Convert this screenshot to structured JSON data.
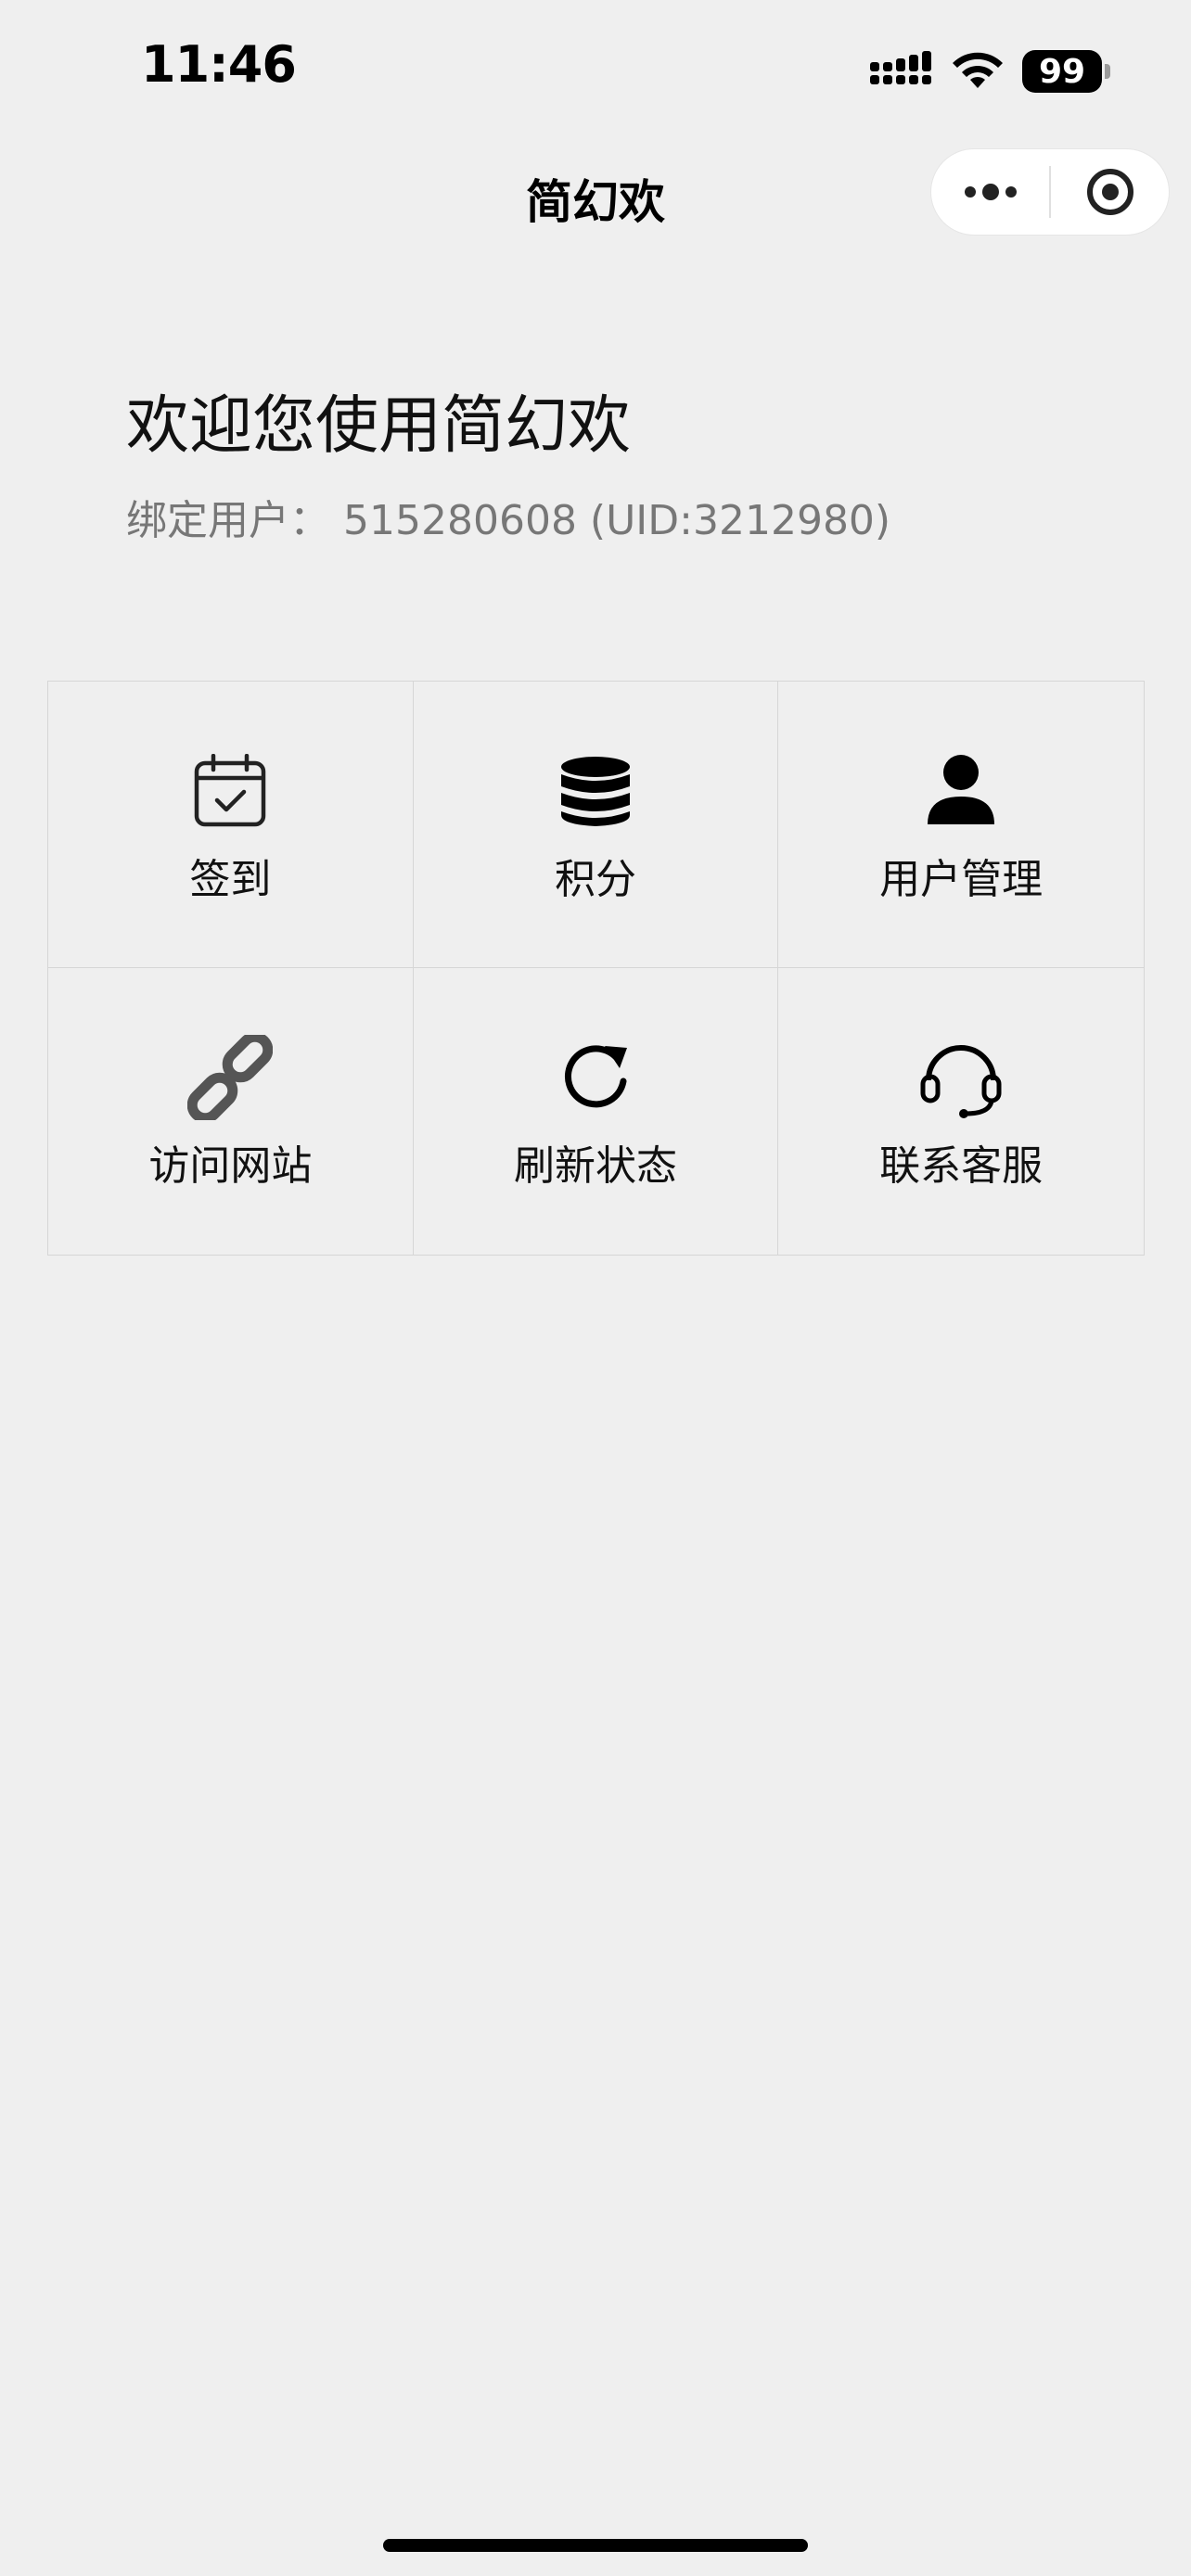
{
  "status_bar": {
    "time": "11:46",
    "battery": "99"
  },
  "nav": {
    "title": "简幻欢",
    "more_icon": "more-dots-icon",
    "close_icon": "target-circle-icon"
  },
  "welcome": {
    "title": "欢迎您使用简幻欢",
    "subtitle": "绑定用户： 515280608 (UID:3212980)"
  },
  "menu": {
    "items": [
      {
        "label": "签到",
        "icon": "calendar-check-icon"
      },
      {
        "label": "积分",
        "icon": "database-icon"
      },
      {
        "label": "用户管理",
        "icon": "user-icon"
      },
      {
        "label": "访问网站",
        "icon": "link-icon"
      },
      {
        "label": "刷新状态",
        "icon": "refresh-icon"
      },
      {
        "label": "联系客服",
        "icon": "headset-icon"
      }
    ]
  },
  "colors": {
    "background": "#efefef",
    "border": "#d6d6d6",
    "text": "#111111",
    "muted": "#777777",
    "link_icon": "#555555"
  }
}
